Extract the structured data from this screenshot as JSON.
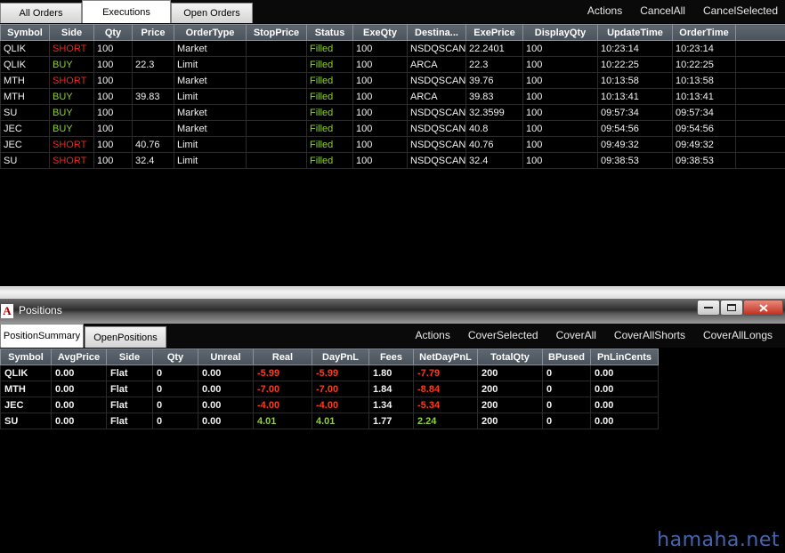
{
  "top_tabs": [
    "All Orders",
    "Executions",
    "Open Orders"
  ],
  "top_actions": [
    "Actions",
    "CancelAll",
    "CancelSelected"
  ],
  "executions": {
    "columns": [
      "Symbol",
      "Side",
      "Qty",
      "Price",
      "OrderType",
      "StopPrice",
      "Status",
      "ExeQty",
      "Destina...",
      "ExePrice",
      "DisplayQty",
      "UpdateTime",
      "OrderTime"
    ],
    "rows": [
      [
        "QLIK",
        "SHORT",
        "100",
        "",
        "Market",
        "",
        "Filled",
        "100",
        "NSDQSCAN",
        "22.2401",
        "100",
        "10:23:14",
        "10:23:14"
      ],
      [
        "QLIK",
        "BUY",
        "100",
        "22.3",
        "Limit",
        "",
        "Filled",
        "100",
        "ARCA",
        "22.3",
        "100",
        "10:22:25",
        "10:22:25"
      ],
      [
        "MTH",
        "SHORT",
        "100",
        "",
        "Market",
        "",
        "Filled",
        "100",
        "NSDQSCAN",
        "39.76",
        "100",
        "10:13:58",
        "10:13:58"
      ],
      [
        "MTH",
        "BUY",
        "100",
        "39.83",
        "Limit",
        "",
        "Filled",
        "100",
        "ARCA",
        "39.83",
        "100",
        "10:13:41",
        "10:13:41"
      ],
      [
        "SU",
        "BUY",
        "100",
        "",
        "Market",
        "",
        "Filled",
        "100",
        "NSDQSCAN",
        "32.3599",
        "100",
        "09:57:34",
        "09:57:34"
      ],
      [
        "JEC",
        "BUY",
        "100",
        "",
        "Market",
        "",
        "Filled",
        "100",
        "NSDQSCAN",
        "40.8",
        "100",
        "09:54:56",
        "09:54:56"
      ],
      [
        "JEC",
        "SHORT",
        "100",
        "40.76",
        "Limit",
        "",
        "Filled",
        "100",
        "NSDQSCAN",
        "40.76",
        "100",
        "09:49:32",
        "09:49:32"
      ],
      [
        "SU",
        "SHORT",
        "100",
        "32.4",
        "Limit",
        "",
        "Filled",
        "100",
        "NSDQSCAN",
        "32.4",
        "100",
        "09:38:53",
        "09:38:53"
      ]
    ]
  },
  "positions_window": {
    "title": "Positions",
    "icon_letter": "A",
    "tabs": [
      "PositionSummary",
      "OpenPositions"
    ],
    "actions": [
      "Actions",
      "CoverSelected",
      "CoverAll",
      "CoverAllShorts",
      "CoverAllLongs"
    ],
    "columns": [
      "Symbol",
      "AvgPrice",
      "Side",
      "Qty",
      "Unreal",
      "Real",
      "DayPnL",
      "Fees",
      "NetDayPnL",
      "TotalQty",
      "BPused",
      "PnLinCents"
    ],
    "rows": [
      [
        "QLIK",
        "0.00",
        "Flat",
        "0",
        "0.00",
        "-5.99",
        "-5.99",
        "1.80",
        "-7.79",
        "200",
        "0",
        "0.00"
      ],
      [
        "MTH",
        "0.00",
        "Flat",
        "0",
        "0.00",
        "-7.00",
        "-7.00",
        "1.84",
        "-8.84",
        "200",
        "0",
        "0.00"
      ],
      [
        "JEC",
        "0.00",
        "Flat",
        "0",
        "0.00",
        "-4.00",
        "-4.00",
        "1.34",
        "-5.34",
        "200",
        "0",
        "0.00"
      ],
      [
        "SU",
        "0.00",
        "Flat",
        "0",
        "0.00",
        "4.01",
        "4.01",
        "1.77",
        "2.24",
        "200",
        "0",
        "0.00"
      ]
    ]
  },
  "colors": {
    "short": "#e8281e",
    "buy": "#8ed12a",
    "filled": "#8ed12a",
    "loss": "#ff3a1a",
    "gain": "#8fd13c"
  },
  "watermark": "hamaha.net"
}
